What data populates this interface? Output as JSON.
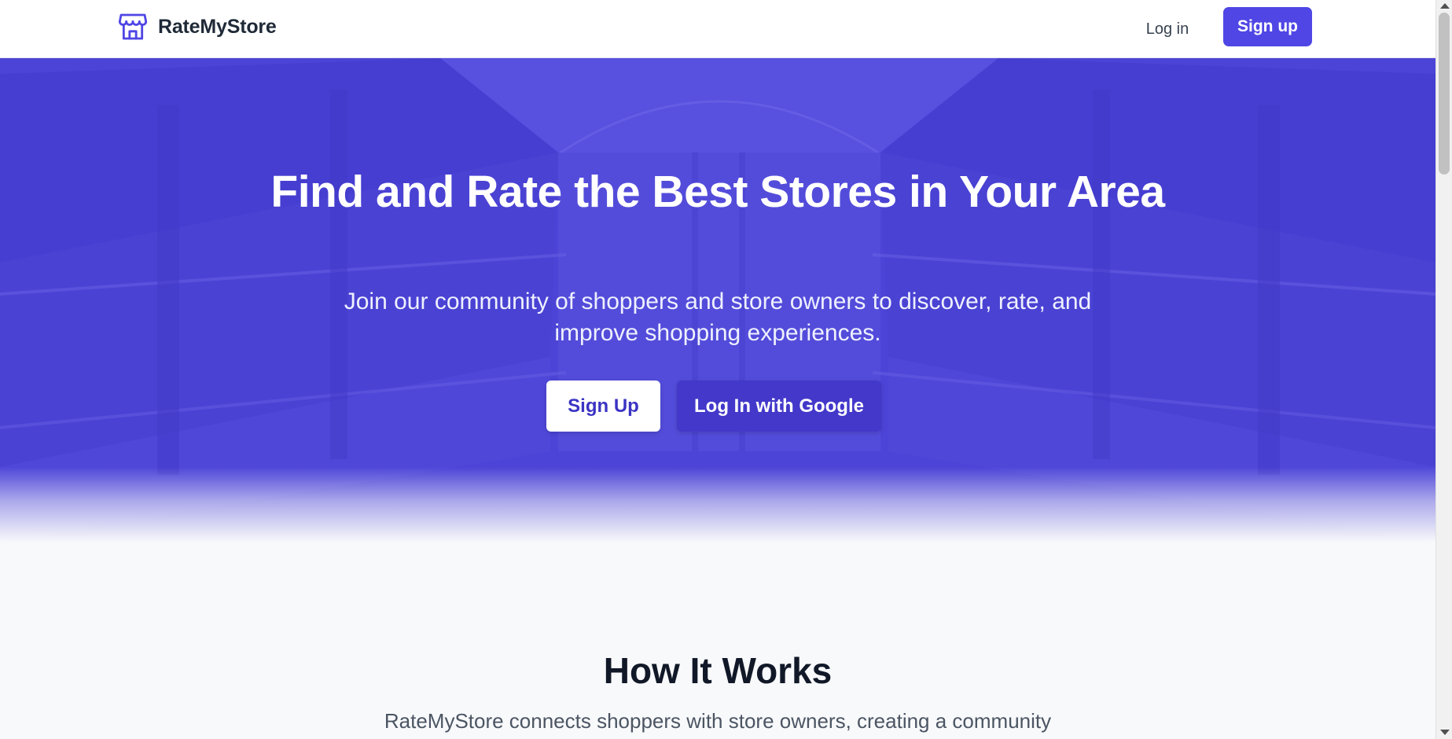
{
  "header": {
    "brand": "RateMyStore",
    "login_label": "Log in",
    "signup_label": "Sign up",
    "logo_icon": "store-icon"
  },
  "hero": {
    "title": "Find and Rate the Best Stores in Your Area",
    "subtitle": "Join our community of shoppers and store owners to discover, rate, and improve shopping experiences.",
    "signup_button": "Sign Up",
    "google_button": "Log In with Google"
  },
  "how_it_works": {
    "title": "How It Works",
    "description": "RateMyStore connects shoppers with store owners, creating a community"
  },
  "colors": {
    "accent": "#4f46e5",
    "hero_overlay": "#4f46e5",
    "google_button": "#4338ca",
    "heading": "#111827"
  }
}
